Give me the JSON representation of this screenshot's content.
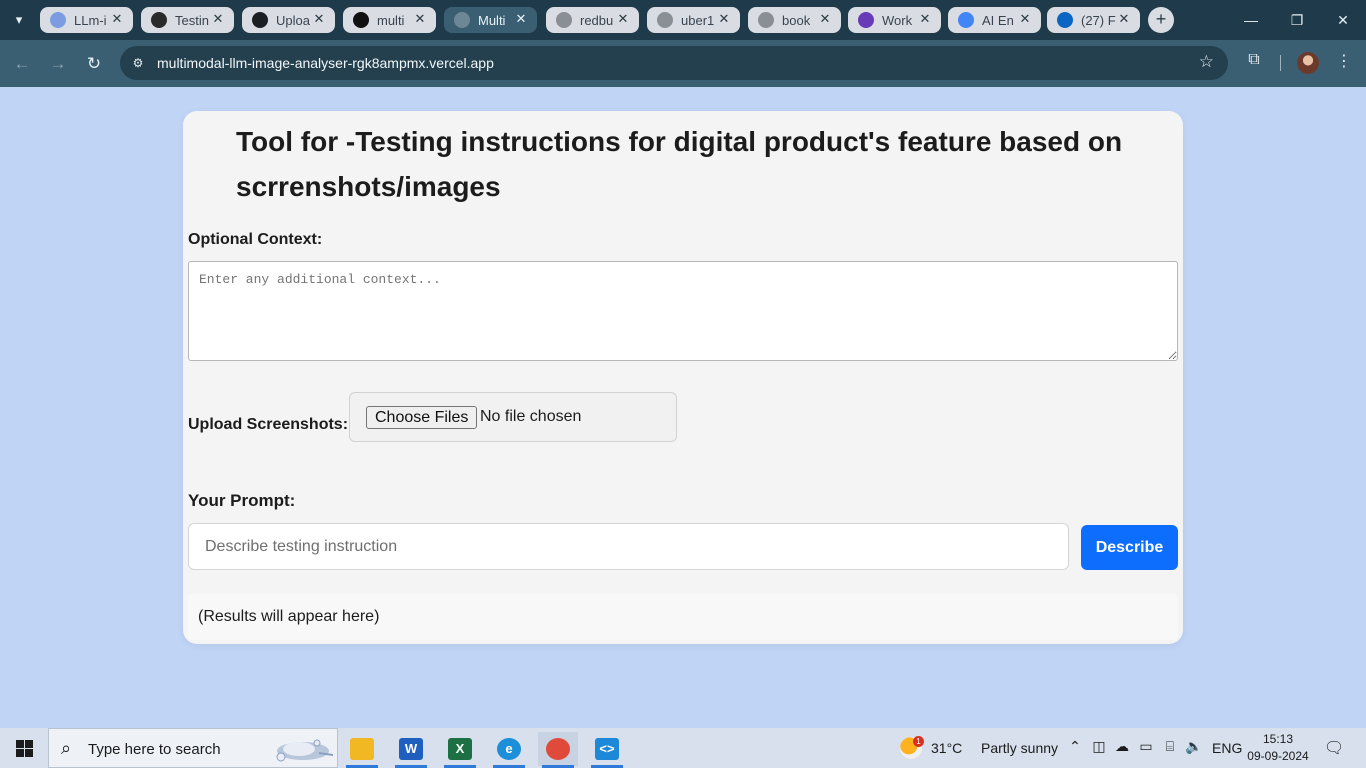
{
  "browser": {
    "tabs": [
      {
        "title": "LLm-i",
        "favicon": "colorful-bars-icon",
        "color": "#7b9ce0"
      },
      {
        "title": "Testin",
        "favicon": "openai-icon",
        "color": "#2a2a2a"
      },
      {
        "title": "Uploa",
        "favicon": "github-icon",
        "color": "#1b1f23"
      },
      {
        "title": "multi",
        "favicon": "vercel-icon",
        "color": "#111111"
      },
      {
        "title": "Multi",
        "favicon": "globe-icon",
        "color": "#6d8796"
      },
      {
        "title": "redbu",
        "favicon": "globe-icon",
        "color": "#8a8f95"
      },
      {
        "title": "uber1",
        "favicon": "globe-icon",
        "color": "#8a8f95"
      },
      {
        "title": "book",
        "favicon": "globe-icon",
        "color": "#8a8f95"
      },
      {
        "title": "Work",
        "favicon": "forms-icon",
        "color": "#673ab7"
      },
      {
        "title": "AI En",
        "favicon": "docs-icon",
        "color": "#4285f4"
      },
      {
        "title": "(27) F",
        "favicon": "linkedin-icon",
        "color": "#0a66c2"
      }
    ],
    "active_tab_index": 4,
    "url": "multimodal-llm-image-analyser-rgk8ampmx.vercel.app"
  },
  "page": {
    "title": "Tool for -Testing instructions for digital product's feature based on scrrenshots/images",
    "context_label": "Optional Context:",
    "context_placeholder": "Enter any additional context...",
    "upload_label": "Upload Screenshots:",
    "choose_files_label": "Choose Files",
    "no_file_text": "No file chosen",
    "prompt_label": "Your Prompt:",
    "prompt_placeholder": "Describe testing instruction",
    "describe_button": "Describe",
    "results_text": "(Results will appear here)"
  },
  "taskbar": {
    "search_placeholder": "Type here to search",
    "apps": [
      {
        "name": "file-explorer",
        "glyph": "",
        "color": "#f2b824"
      },
      {
        "name": "word",
        "glyph": "W",
        "color": "#1f5fbf"
      },
      {
        "name": "excel",
        "glyph": "X",
        "color": "#1d7044"
      },
      {
        "name": "edge",
        "glyph": "e",
        "color": "#1c8fd8"
      },
      {
        "name": "chrome",
        "glyph": "",
        "color": "#e04a3a"
      },
      {
        "name": "vscode",
        "glyph": "<>",
        "color": "#1e88d8"
      }
    ],
    "weather": {
      "temp": "31°C",
      "condition": "Partly sunny",
      "badge": "1"
    },
    "language": "ENG",
    "time": "15:13",
    "date": "09-09-2024"
  },
  "colors": {
    "page_background": "#c0d4f5",
    "primary_button": "#0d6efd",
    "chrome_dark": "#1f3a4a",
    "chrome_toolbar": "#3a5f72"
  }
}
